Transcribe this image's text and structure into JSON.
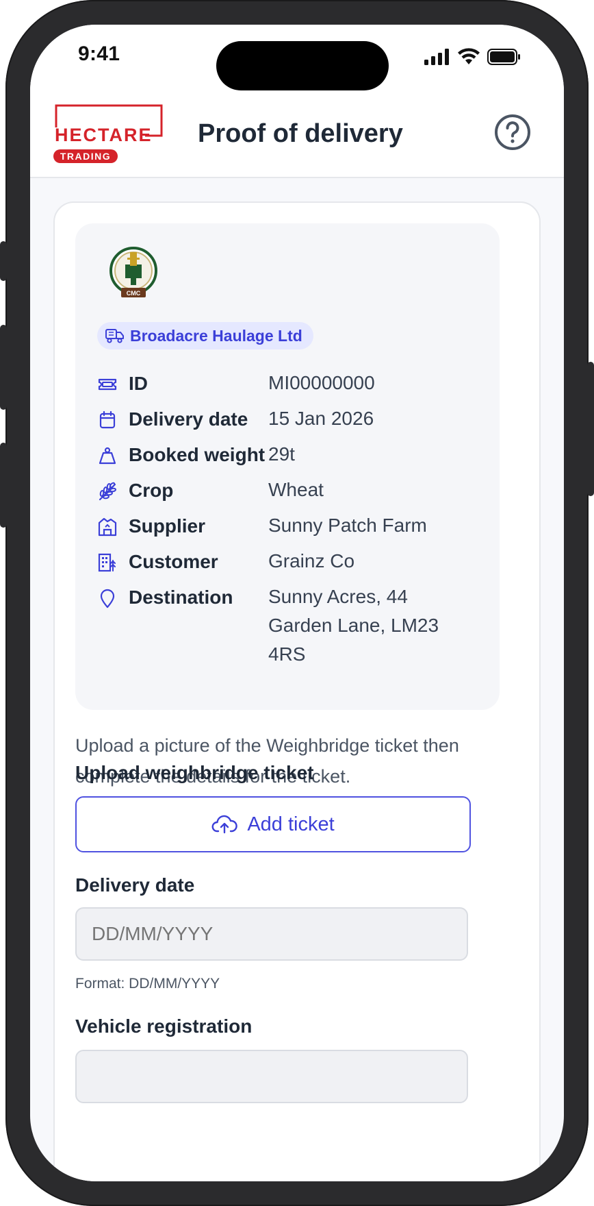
{
  "status_bar": {
    "time": "9:41"
  },
  "header": {
    "title": "Proof of delivery",
    "logo": {
      "word": "HECTARE",
      "tag": "TRADING"
    }
  },
  "delivery": {
    "crest_text": "CMC",
    "haulier": "Broadacre Haulage Ltd",
    "rows": [
      {
        "icon": "ticket-icon",
        "label": "ID",
        "value": "MI00000000"
      },
      {
        "icon": "calendar-icon",
        "label": "Delivery date",
        "value": "15 Jan 2026"
      },
      {
        "icon": "weight-icon",
        "label": "Booked weight",
        "value": "29t"
      },
      {
        "icon": "wheat-icon",
        "label": "Crop",
        "value": "Wheat"
      },
      {
        "icon": "farm-building-icon",
        "label": "Supplier",
        "value": "Sunny Patch Farm"
      },
      {
        "icon": "office-building-icon",
        "label": "Customer",
        "value": "Grainz Co"
      },
      {
        "icon": "map-pin-icon",
        "label": "Destination",
        "value": "Sunny Acres, 44 Garden Lane, LM23 4RS"
      }
    ]
  },
  "form": {
    "intro": "Upload a picture of the Weighbridge ticket then complete the details for the ticket.",
    "upload_label": "Upload weighbridge ticket",
    "add_ticket": "Add ticket",
    "date_label": "Delivery date",
    "date_placeholder": "DD/MM/YYYY",
    "date_hint": "Format: DD/MM/YYYY",
    "vehicle_label": "Vehicle registration",
    "vehicle_placeholder": ""
  },
  "colors": {
    "accent": "#3b3fd8",
    "brand_red": "#d5232a",
    "crest_green": "#1f5d2f"
  }
}
